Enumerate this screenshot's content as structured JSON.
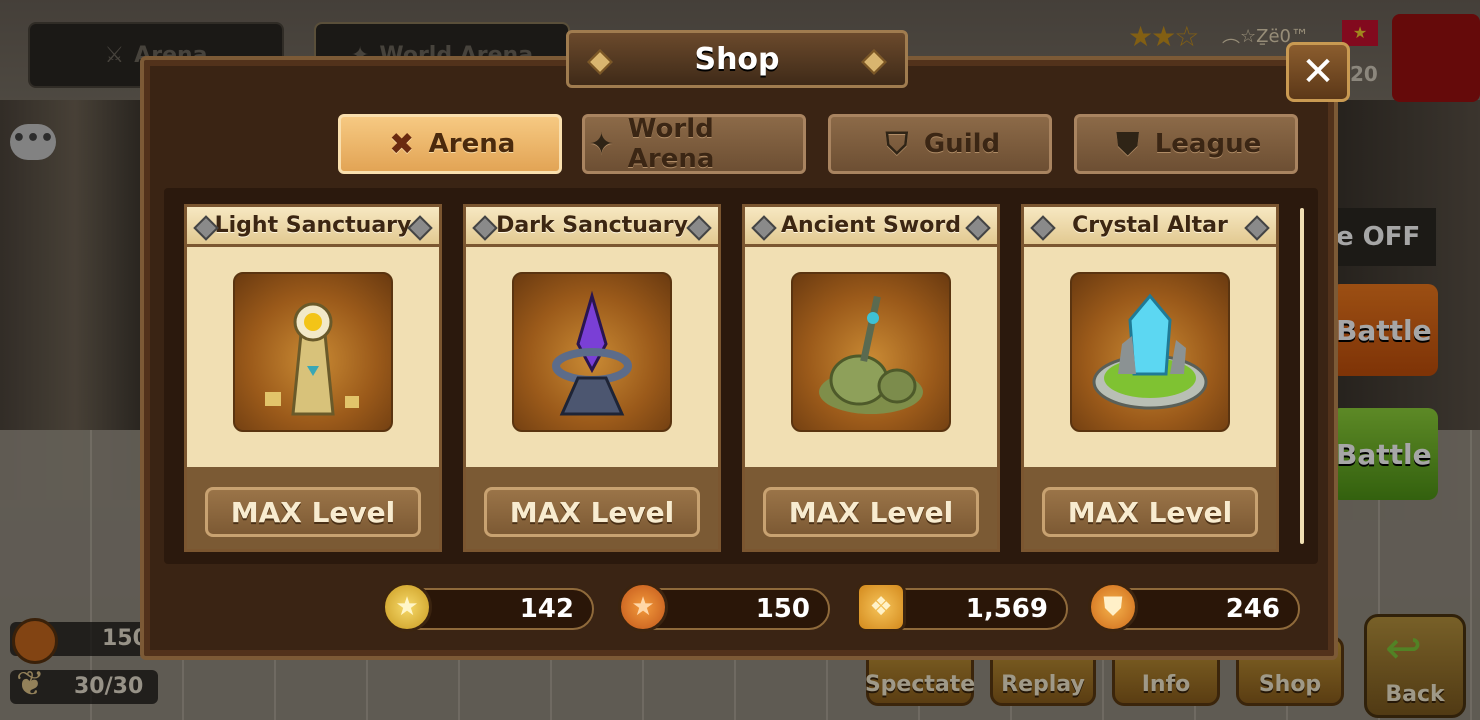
{
  "background": {
    "tabs": [
      "Arena",
      "World Arena"
    ],
    "player": {
      "stars": "★★☆",
      "name": "︵☆Ẕё0™",
      "level": "20"
    },
    "side": {
      "off_label": "e OFF",
      "battle1": "Battle",
      "battle2": "Battle"
    },
    "bottom_buttons": [
      "Spectate",
      "Replay",
      "Info",
      "Shop",
      "Back"
    ],
    "left_resources": {
      "medal_value": "150",
      "wings_value": "30/30"
    }
  },
  "shop": {
    "title": "Shop",
    "close_label": "✕",
    "tabs": [
      {
        "label": "Arena",
        "icon": "crossed-swords-icon",
        "active": true
      },
      {
        "label": "World Arena",
        "icon": "world-compass-icon",
        "active": false
      },
      {
        "label": "Guild",
        "icon": "guild-shield-icon",
        "active": false
      },
      {
        "label": "League",
        "icon": "league-shield-icon",
        "active": false
      }
    ],
    "items": [
      {
        "name": "Light Sanctuary",
        "icon": "light-sanctuary-icon",
        "button": "MAX Level"
      },
      {
        "name": "Dark Sanctuary",
        "icon": "dark-sanctuary-icon",
        "button": "MAX Level"
      },
      {
        "name": "Ancient Sword",
        "icon": "ancient-sword-icon",
        "button": "MAX Level"
      },
      {
        "name": "Crystal Altar",
        "icon": "crystal-altar-icon",
        "button": "MAX Level"
      }
    ],
    "currencies": [
      {
        "icon": "gold-star-medal-icon",
        "value": "142"
      },
      {
        "icon": "orange-star-medal-icon",
        "value": "150"
      },
      {
        "icon": "rank-chevron-medal-icon",
        "value": "1,569"
      },
      {
        "icon": "shield-medal-icon",
        "value": "246"
      }
    ]
  },
  "colors": {
    "active_tab": "#f0b968",
    "inactive_tab": "#7d5b3c",
    "frame": "#3a2414",
    "card": "#f1dfb3"
  }
}
